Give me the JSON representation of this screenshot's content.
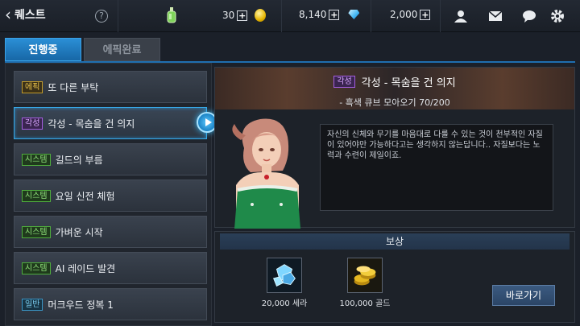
{
  "header": {
    "back_label": "퀘스트",
    "help_label": "?",
    "stats": {
      "stamina": "30",
      "gold": "8,140",
      "gems": "2,000"
    },
    "plus": "+"
  },
  "tabs": [
    {
      "label": "진행중",
      "active": true
    },
    {
      "label": "에픽완료",
      "active": false
    }
  ],
  "quests": [
    {
      "badge": "에픽",
      "name": "또 다른 부탁",
      "type": "epic"
    },
    {
      "badge": "각성",
      "name": "각성 - 목숨을 건 의지",
      "type": "awak",
      "selected": true
    },
    {
      "badge": "시스템",
      "name": "길드의 부름",
      "type": "sys"
    },
    {
      "badge": "시스템",
      "name": "요일 신전 체험",
      "type": "sys"
    },
    {
      "badge": "시스템",
      "name": "가벼운 시작",
      "type": "sys"
    },
    {
      "badge": "시스템",
      "name": "AI 레이드 발견",
      "type": "sys"
    },
    {
      "badge": "일반",
      "name": "머크우드 정복 1",
      "type": "norm"
    }
  ],
  "detail": {
    "badge": "각성",
    "title": "각성 - 목숨을 건 의지",
    "objective": "- 흑색 큐브 모아오기 70/200",
    "description": "자신의 신체와 무기를 마음대로 다룰 수 있는 것이 천부적인 자질이 있어야만 가능하다고는 생각하지 않는답니다.. 자질보다는 노력과 수련이 제일이죠."
  },
  "reward": {
    "header": "보상",
    "items": [
      {
        "label": "20,000 세라",
        "icon": "sera-crystal-icon"
      },
      {
        "label": "100,000 골드",
        "icon": "gold-coins-icon"
      }
    ],
    "go_button": "바로가기"
  },
  "colors": {
    "accent": "#1f6fb0",
    "selected_border": "#37a8e6"
  }
}
